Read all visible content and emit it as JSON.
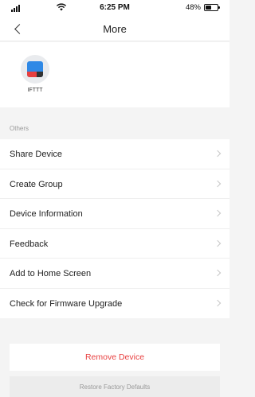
{
  "status_bar": {
    "time": "6:25 PM",
    "battery_percent": "48%",
    "battery_level": 0.48,
    "icons": [
      "signal-icon",
      "wifi-icon",
      "battery-icon"
    ]
  },
  "nav": {
    "title": "More",
    "back_icon": "chevron-left-icon"
  },
  "apps": [
    {
      "label": "IFTTT",
      "icon": "ifttt-logo-icon"
    }
  ],
  "section": {
    "title": "Others"
  },
  "menu": [
    {
      "label": "Share Device"
    },
    {
      "label": "Create Group"
    },
    {
      "label": "Device Information"
    },
    {
      "label": "Feedback"
    },
    {
      "label": "Add to Home Screen"
    },
    {
      "label": "Check for Firmware Upgrade"
    }
  ],
  "actions": {
    "remove_label": "Remove Device",
    "restore_label": "Restore Factory Defaults"
  },
  "colors": {
    "danger": "#e84040",
    "background": "#f4f4f4",
    "surface": "#ffffff",
    "muted_text": "#999999"
  }
}
